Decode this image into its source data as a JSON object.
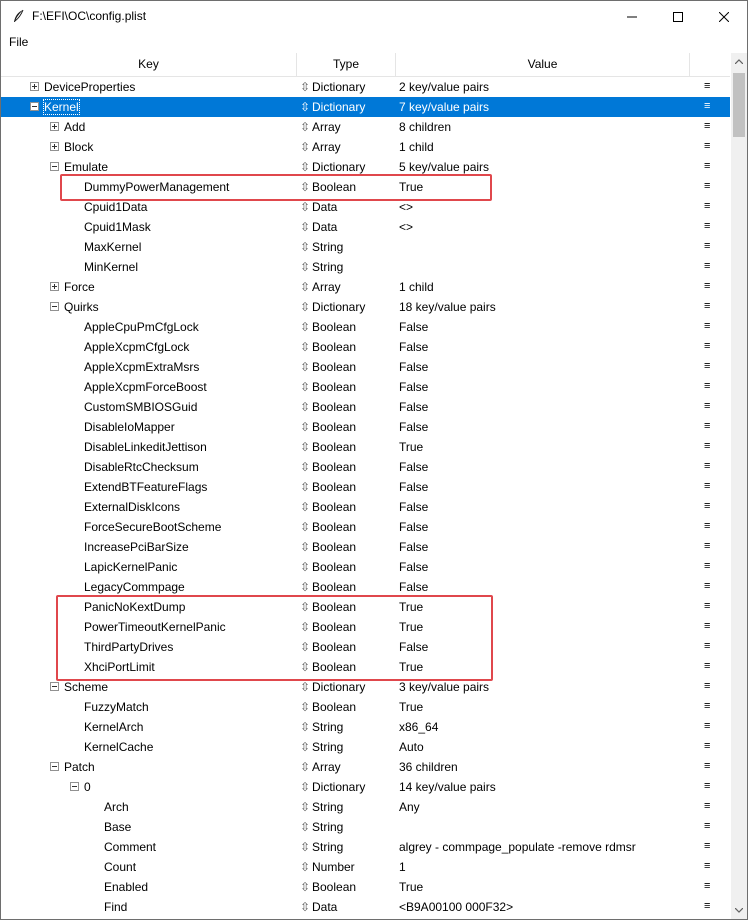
{
  "window": {
    "title": "F:\\EFI\\OC\\config.plist"
  },
  "menu": {
    "file": "File"
  },
  "columns": {
    "key": "Key",
    "type": "Type",
    "value": "Value"
  },
  "drag_glyph": "≡",
  "type_glyph": "⇳",
  "colors": {
    "selection": "#0078d7",
    "highlight_box": "#e0474c"
  },
  "rows": [
    {
      "key": "DeviceProperties",
      "type": "Dictionary",
      "value": "2 key/value pairs",
      "depth": 0,
      "expander": "plus"
    },
    {
      "key": "Kernel",
      "type": "Dictionary",
      "value": "7 key/value pairs",
      "depth": 0,
      "expander": "minus",
      "selected": true
    },
    {
      "key": "Add",
      "type": "Array",
      "value": "8 children",
      "depth": 1,
      "expander": "plus"
    },
    {
      "key": "Block",
      "type": "Array",
      "value": "1 child",
      "depth": 1,
      "expander": "plus"
    },
    {
      "key": "Emulate",
      "type": "Dictionary",
      "value": "5 key/value pairs",
      "depth": 1,
      "expander": "minus"
    },
    {
      "key": "DummyPowerManagement",
      "type": "Boolean",
      "value": "True",
      "depth": 2
    },
    {
      "key": "Cpuid1Data",
      "type": "Data",
      "value": "<>",
      "depth": 2
    },
    {
      "key": "Cpuid1Mask",
      "type": "Data",
      "value": "<>",
      "depth": 2
    },
    {
      "key": "MaxKernel",
      "type": "String",
      "value": "",
      "depth": 2
    },
    {
      "key": "MinKernel",
      "type": "String",
      "value": "",
      "depth": 2
    },
    {
      "key": "Force",
      "type": "Array",
      "value": "1 child",
      "depth": 1,
      "expander": "plus"
    },
    {
      "key": "Quirks",
      "type": "Dictionary",
      "value": "18 key/value pairs",
      "depth": 1,
      "expander": "minus"
    },
    {
      "key": "AppleCpuPmCfgLock",
      "type": "Boolean",
      "value": "False",
      "depth": 2
    },
    {
      "key": "AppleXcpmCfgLock",
      "type": "Boolean",
      "value": "False",
      "depth": 2
    },
    {
      "key": "AppleXcpmExtraMsrs",
      "type": "Boolean",
      "value": "False",
      "depth": 2
    },
    {
      "key": "AppleXcpmForceBoost",
      "type": "Boolean",
      "value": "False",
      "depth": 2
    },
    {
      "key": "CustomSMBIOSGuid",
      "type": "Boolean",
      "value": "False",
      "depth": 2
    },
    {
      "key": "DisableIoMapper",
      "type": "Boolean",
      "value": "False",
      "depth": 2
    },
    {
      "key": "DisableLinkeditJettison",
      "type": "Boolean",
      "value": "True",
      "depth": 2
    },
    {
      "key": "DisableRtcChecksum",
      "type": "Boolean",
      "value": "False",
      "depth": 2
    },
    {
      "key": "ExtendBTFeatureFlags",
      "type": "Boolean",
      "value": "False",
      "depth": 2
    },
    {
      "key": "ExternalDiskIcons",
      "type": "Boolean",
      "value": "False",
      "depth": 2
    },
    {
      "key": "ForceSecureBootScheme",
      "type": "Boolean",
      "value": "False",
      "depth": 2
    },
    {
      "key": "IncreasePciBarSize",
      "type": "Boolean",
      "value": "False",
      "depth": 2
    },
    {
      "key": "LapicKernelPanic",
      "type": "Boolean",
      "value": "False",
      "depth": 2
    },
    {
      "key": "LegacyCommpage",
      "type": "Boolean",
      "value": "False",
      "depth": 2
    },
    {
      "key": "PanicNoKextDump",
      "type": "Boolean",
      "value": "True",
      "depth": 2
    },
    {
      "key": "PowerTimeoutKernelPanic",
      "type": "Boolean",
      "value": "True",
      "depth": 2
    },
    {
      "key": "ThirdPartyDrives",
      "type": "Boolean",
      "value": "False",
      "depth": 2
    },
    {
      "key": "XhciPortLimit",
      "type": "Boolean",
      "value": "True",
      "depth": 2
    },
    {
      "key": "Scheme",
      "type": "Dictionary",
      "value": "3 key/value pairs",
      "depth": 1,
      "expander": "minus"
    },
    {
      "key": "FuzzyMatch",
      "type": "Boolean",
      "value": "True",
      "depth": 2
    },
    {
      "key": "KernelArch",
      "type": "String",
      "value": "x86_64",
      "depth": 2
    },
    {
      "key": "KernelCache",
      "type": "String",
      "value": "Auto",
      "depth": 2
    },
    {
      "key": "Patch",
      "type": "Array",
      "value": "36 children",
      "depth": 1,
      "expander": "minus"
    },
    {
      "key": "0",
      "type": "Dictionary",
      "value": "14 key/value pairs",
      "depth": 2,
      "expander": "minus"
    },
    {
      "key": "Arch",
      "type": "String",
      "value": "Any",
      "depth": 3
    },
    {
      "key": "Base",
      "type": "String",
      "value": "",
      "depth": 3
    },
    {
      "key": "Comment",
      "type": "String",
      "value": "algrey - commpage_populate -remove rdmsr",
      "depth": 3
    },
    {
      "key": "Count",
      "type": "Number",
      "value": "1",
      "depth": 3
    },
    {
      "key": "Enabled",
      "type": "Boolean",
      "value": "True",
      "depth": 3
    },
    {
      "key": "Find",
      "type": "Data",
      "value": "<B9A00100 000F32>",
      "depth": 3
    }
  ]
}
